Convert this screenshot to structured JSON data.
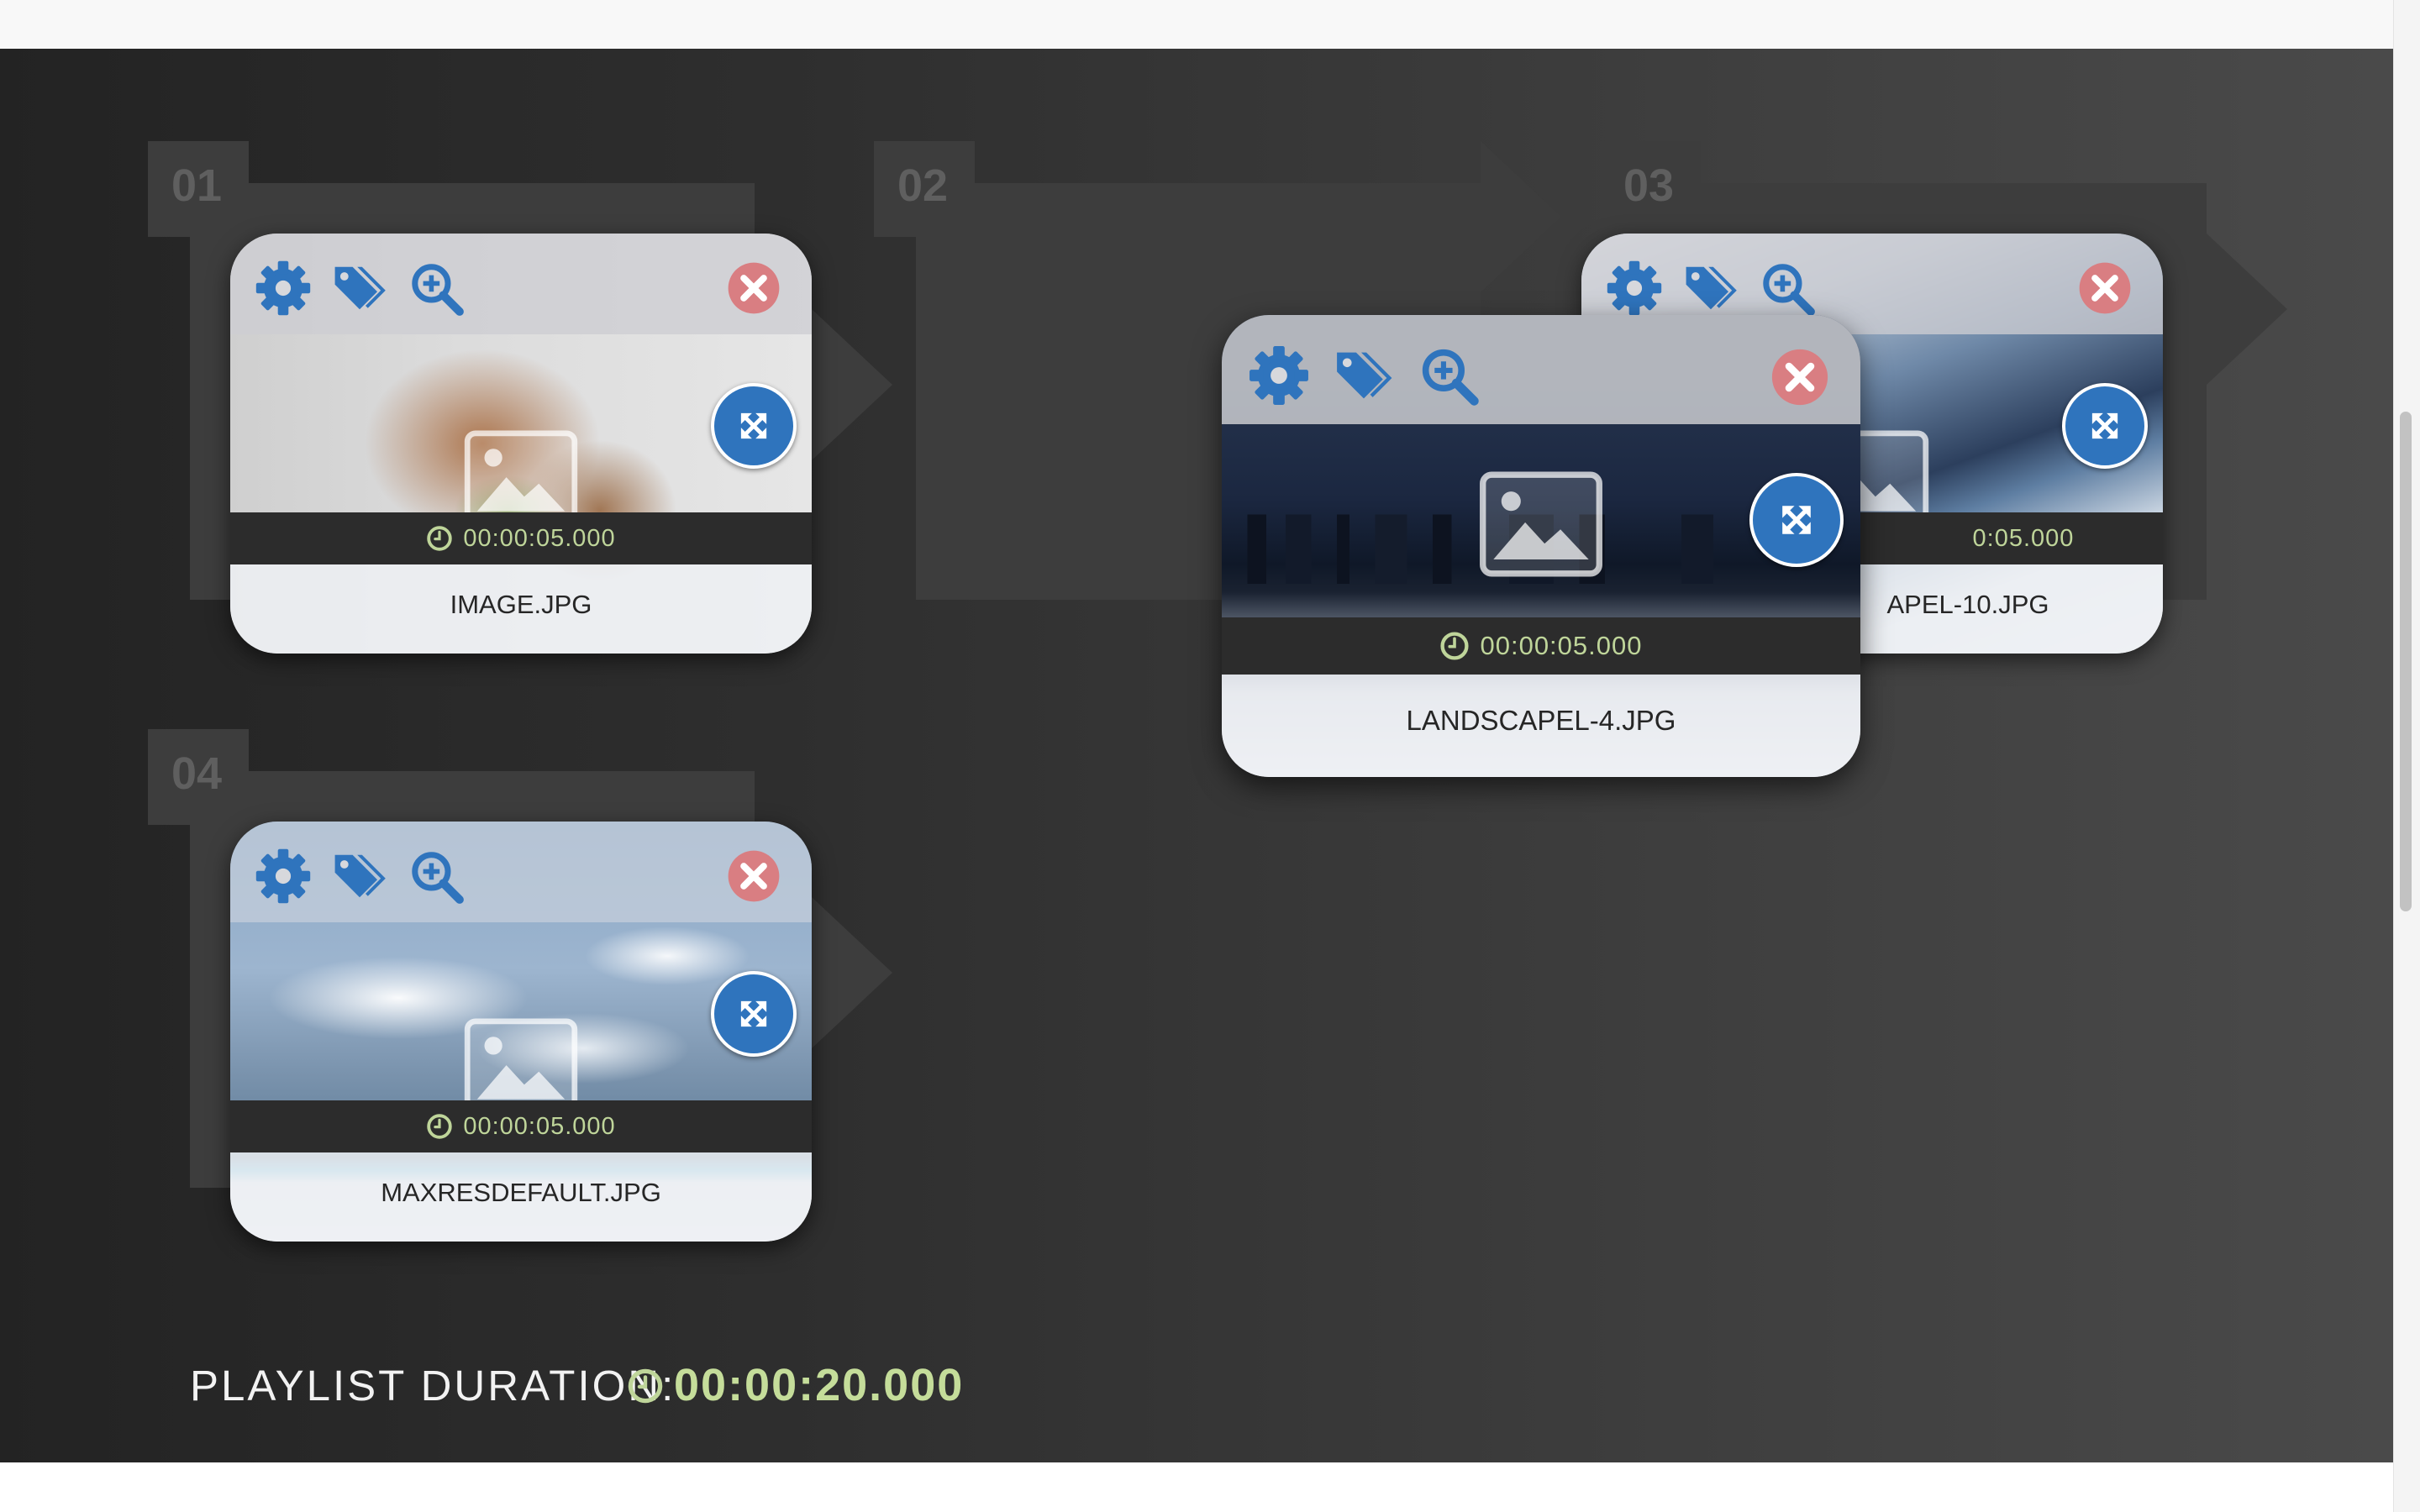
{
  "colors": {
    "accent": "#2f74bd",
    "close": "#d97e82",
    "time": "#bfd59a",
    "slot_frame": "#3d3d3d",
    "slot_number": "#5f5f5f"
  },
  "slots": [
    {
      "number": "01"
    },
    {
      "number": "02"
    },
    {
      "number": "03"
    },
    {
      "number": "04"
    }
  ],
  "cards": [
    {
      "filename": "IMAGE.JPG",
      "duration": "00:00:05.000",
      "icons": [
        "gear-icon",
        "tag-icon",
        "zoom-in-icon",
        "close-icon",
        "expand-icon",
        "image-placeholder-icon",
        "clock-icon"
      ]
    },
    {
      "filename": "LANDSCAPEL-4.JPG",
      "duration": "00:00:05.000",
      "icons": [
        "gear-icon",
        "tag-icon",
        "zoom-in-icon",
        "close-icon",
        "expand-icon",
        "image-placeholder-icon",
        "clock-icon"
      ]
    },
    {
      "filename": "APEL-10.JPG",
      "duration": "0:05.000",
      "icons": [
        "gear-icon",
        "tag-icon",
        "zoom-in-icon",
        "close-icon",
        "expand-icon",
        "image-placeholder-icon"
      ]
    },
    {
      "filename": "MAXRESDEFAULT.JPG",
      "duration": "00:00:05.000",
      "icons": [
        "gear-icon",
        "tag-icon",
        "zoom-in-icon",
        "close-icon",
        "expand-icon",
        "image-placeholder-icon",
        "clock-icon"
      ]
    }
  ],
  "playlist": {
    "label": "PLAYLIST DURATION:",
    "total": "00:00:20.000"
  }
}
